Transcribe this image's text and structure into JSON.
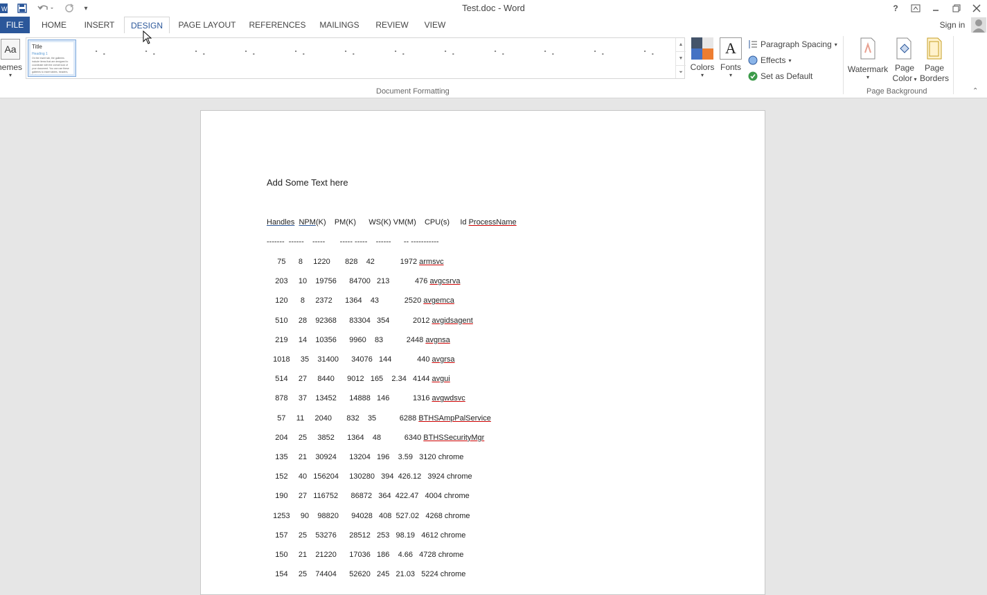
{
  "window": {
    "title": "Test.doc - Word"
  },
  "qat": {
    "word_icon": "word-icon",
    "save": "save-icon",
    "undo": "undo-icon",
    "redo": "redo-icon",
    "customize": "customize-qat-icon"
  },
  "window_controls": {
    "help": "?",
    "restore_ribbon": "ribbon-display-icon",
    "minimize": "—",
    "restore": "restore-icon",
    "close": "✕"
  },
  "tabs": [
    {
      "label": "FILE"
    },
    {
      "label": "HOME"
    },
    {
      "label": "INSERT"
    },
    {
      "label": "DESIGN"
    },
    {
      "label": "PAGE LAYOUT"
    },
    {
      "label": "REFERENCES"
    },
    {
      "label": "MAILINGS"
    },
    {
      "label": "REVIEW"
    },
    {
      "label": "VIEW"
    }
  ],
  "sign_in": "Sign in",
  "ribbon": {
    "themes_label": "Themes",
    "themes_partial": "hemes",
    "gallery_first_title": "Title",
    "gallery_first_heading": "Heading 1",
    "gallery_first_body": "On the Insert tab, the galleries include items that are designed to coordinate with the overall look of your document. You can use these galleries to insert tables, headers, footers, lists, cover pages",
    "colors_label": "Colors",
    "fonts_label": "Fonts",
    "fonts_glyph": "A",
    "paragraph_spacing": "Paragraph Spacing",
    "effects": "Effects",
    "set_as_default": "Set as Default",
    "document_formatting": "Document Formatting",
    "watermark": "Watermark",
    "page_color_1": "Page",
    "page_color_2": "Color",
    "page_borders_1": "Page",
    "page_borders_2": "Borders",
    "page_background": "Page Background"
  },
  "document": {
    "intro": "Add Some Text here",
    "header_parts": {
      "handles": "Handles",
      "npm": "NPM",
      "k": "(K)",
      "rest": "    PM(K)      WS(K) VM(M)    CPU(s)     Id ",
      "pname": "ProcessName"
    },
    "separator": "-------  ------    -----       ----- -----    ------      -- -----------",
    "rows": [
      {
        "text": "     75      8     1220       828    42            1972 ",
        "name": "armsvc"
      },
      {
        "text": "    203     10    19756      84700   213            476 ",
        "name": "avgcsrva"
      },
      {
        "text": "    120      8     2372      1364    43            2520 ",
        "name": "avgemca"
      },
      {
        "text": "    510     28    92368      83304   354           2012 ",
        "name": "avgidsagent"
      },
      {
        "text": "    219     14    10356      9960    83           2448 ",
        "name": "avgnsa"
      },
      {
        "text": "   1018     35    31400      34076   144            440 ",
        "name": "avgrsa"
      },
      {
        "text": "    514     27     8440      9012   165    2.34   4144 ",
        "name": "avgui"
      },
      {
        "text": "    878     37    13452      14888   146           1316 ",
        "name": "avgwdsvc"
      },
      {
        "text": "     57     11     2040       832    35           6288 ",
        "name": "BTHSAmpPalService"
      },
      {
        "text": "    204     25     3852      1364    48           6340 ",
        "name": "BTHSSecurityMgr"
      },
      {
        "text": "    135     21    30924      13204   196    3.59   3120 ",
        "name": "chrome"
      },
      {
        "text": "    152     40   156204     130280   394  426.12   3924 ",
        "name": "chrome"
      },
      {
        "text": "    190     27   116752      86872   364  422.47   4004 ",
        "name": "chrome"
      },
      {
        "text": "   1253     90    98820      94028   408  527.02   4268 ",
        "name": "chrome"
      },
      {
        "text": "    157     25    53276      28512   253   98.19   4612 ",
        "name": "chrome"
      },
      {
        "text": "    150     21    21220      17036   186    4.66   4728 ",
        "name": "chrome"
      },
      {
        "text": "    154     25    74404      52620   245   21.03   5224 ",
        "name": "chrome"
      }
    ]
  }
}
